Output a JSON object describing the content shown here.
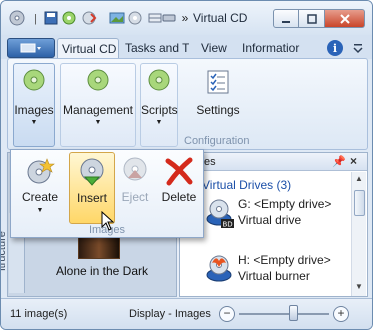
{
  "window": {
    "title": "Virtual CD"
  },
  "quick_access": {
    "icons": [
      "app-disc-icon",
      "save-icon",
      "undo-icon",
      "image-icon",
      "disc-icon",
      "eject-icon",
      "grid-icon",
      "drive-icon"
    ],
    "more": "»"
  },
  "tabs": [
    {
      "label": "Virtual CD",
      "active": true
    },
    {
      "label": "Tasks and T",
      "active": false
    },
    {
      "label": "View",
      "active": false
    },
    {
      "label": "Informatior",
      "active": false
    }
  ],
  "help_label": "i",
  "ribbon": {
    "buttons": [
      {
        "label": "Images",
        "has_arrow": true,
        "icon": "disc-icon"
      },
      {
        "label": "Management",
        "has_arrow": true,
        "icon": "disc-icon"
      },
      {
        "label": "Scripts",
        "has_arrow": true,
        "icon": "disc-icon"
      },
      {
        "label": "Settings",
        "has_arrow": false,
        "icon": "settings-list-icon"
      }
    ],
    "group_label": "Configuration"
  },
  "popup": {
    "buttons": [
      {
        "label": "Create",
        "has_arrow": true,
        "state": "normal",
        "icon": "create-disc-icon"
      },
      {
        "label": "Insert",
        "has_arrow": false,
        "state": "hover",
        "icon": "insert-disc-icon"
      },
      {
        "label": "Eject",
        "has_arrow": false,
        "state": "disabled",
        "icon": "eject-disc-icon"
      },
      {
        "label": "Delete",
        "has_arrow": false,
        "state": "normal",
        "icon": "delete-x-icon"
      }
    ],
    "group_label": "Images"
  },
  "left_pane": {
    "side_tab": "itructure",
    "item_label": "Alone in the Dark"
  },
  "right_pane": {
    "header": "es",
    "section": "Virtual Drives (3)",
    "drives": [
      {
        "line1": "G: <Empty drive>",
        "line2": "Virtual drive",
        "badge": "BD"
      },
      {
        "line1": "H: <Empty drive>",
        "line2": "Virtual burner",
        "badge": ""
      }
    ]
  },
  "status": {
    "count": "11 image(s)",
    "display": "Display - Images",
    "zoom_out": "−",
    "zoom_in": "+",
    "zoom_level": 0.6
  },
  "colors": {
    "accent": "#2a63b8",
    "hover_fill": "#ffd768",
    "delete": "#d42a1c",
    "link": "#1b4fa8"
  }
}
